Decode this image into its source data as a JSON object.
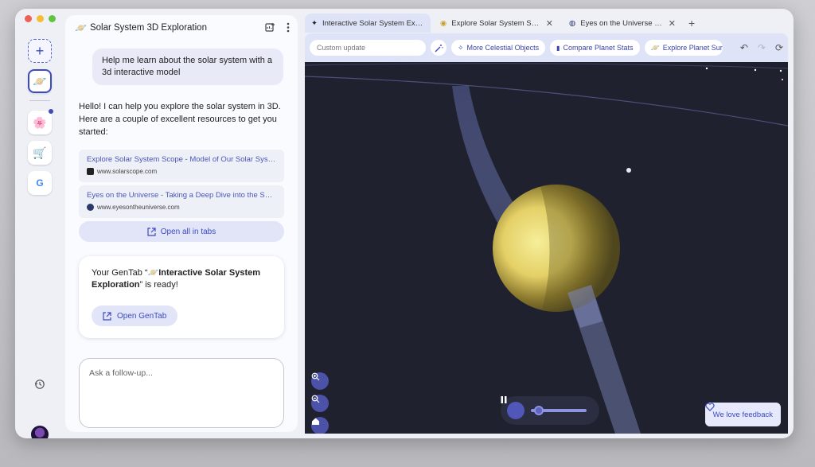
{
  "window": {
    "colors": {
      "accent": "#3c4bc0",
      "scene_bg": "#20212f",
      "planet": "#e8d66a"
    }
  },
  "rail": {
    "items": [
      {
        "name": "new-chat",
        "icon": "plus-icon",
        "glyph": "+"
      },
      {
        "name": "solar-system",
        "icon": "saturn-icon",
        "glyph": "🪐"
      },
      {
        "name": "flower",
        "icon": "flower-icon",
        "glyph": "🌸"
      },
      {
        "name": "cart",
        "icon": "cart-icon",
        "glyph": "🛒"
      },
      {
        "name": "google",
        "icon": "google-icon",
        "glyph": "G"
      }
    ]
  },
  "panel": {
    "title": "Solar System 3D Exploration",
    "title_icon": "🪐",
    "user_message": "Help me learn about the solar system with a 3d interactive model",
    "assistant_message": "Hello! I can help you explore the solar system in 3D. Here are a couple of excellent resources to get you started:",
    "links": [
      {
        "title": "Explore Solar System Scope - Model of Our Solar Syste...",
        "source": "www.solarscope.com",
        "icon_color": "#222222"
      },
      {
        "title": "Eyes on the Universe - Taking a Deep Dive into the Sola...",
        "source": "www.eyesontheuniverse.com",
        "icon_color": "#2b3a6a"
      }
    ],
    "open_all_label": "Open all in tabs",
    "gentab_prefix": "Your GenTab “",
    "gentab_icon": "🪐",
    "gentab_name": "Interactive Solar System Exploration",
    "gentab_suffix": "” is ready!",
    "open_gentab_label": "Open GenTab",
    "ask_placeholder": "Ask a follow-up..."
  },
  "browser": {
    "tabs": [
      {
        "label": "Interactive Solar System Explor...",
        "icon": "sparkle-icon",
        "glyph": "✦",
        "active": true
      },
      {
        "label": "Explore Solar System Scope - ...",
        "icon": "solarscope-icon",
        "glyph": "◉"
      },
      {
        "label": "Eyes on the Universe - Taking ...",
        "icon": "eyes-icon",
        "glyph": "◍"
      }
    ],
    "new_tab": "+",
    "close_glyph": "✕",
    "custom_update_placeholder": "Custom update",
    "chips": [
      {
        "label": "More Celestial Objects",
        "icon": "✧"
      },
      {
        "label": "Compare Planet Stats",
        "icon": "▮"
      },
      {
        "label": "Explore Planet Surfac",
        "icon": "🪐"
      }
    ],
    "undo": "↶",
    "redo": "↷",
    "sync": "⟳",
    "feedback_label": "We love feedback"
  }
}
